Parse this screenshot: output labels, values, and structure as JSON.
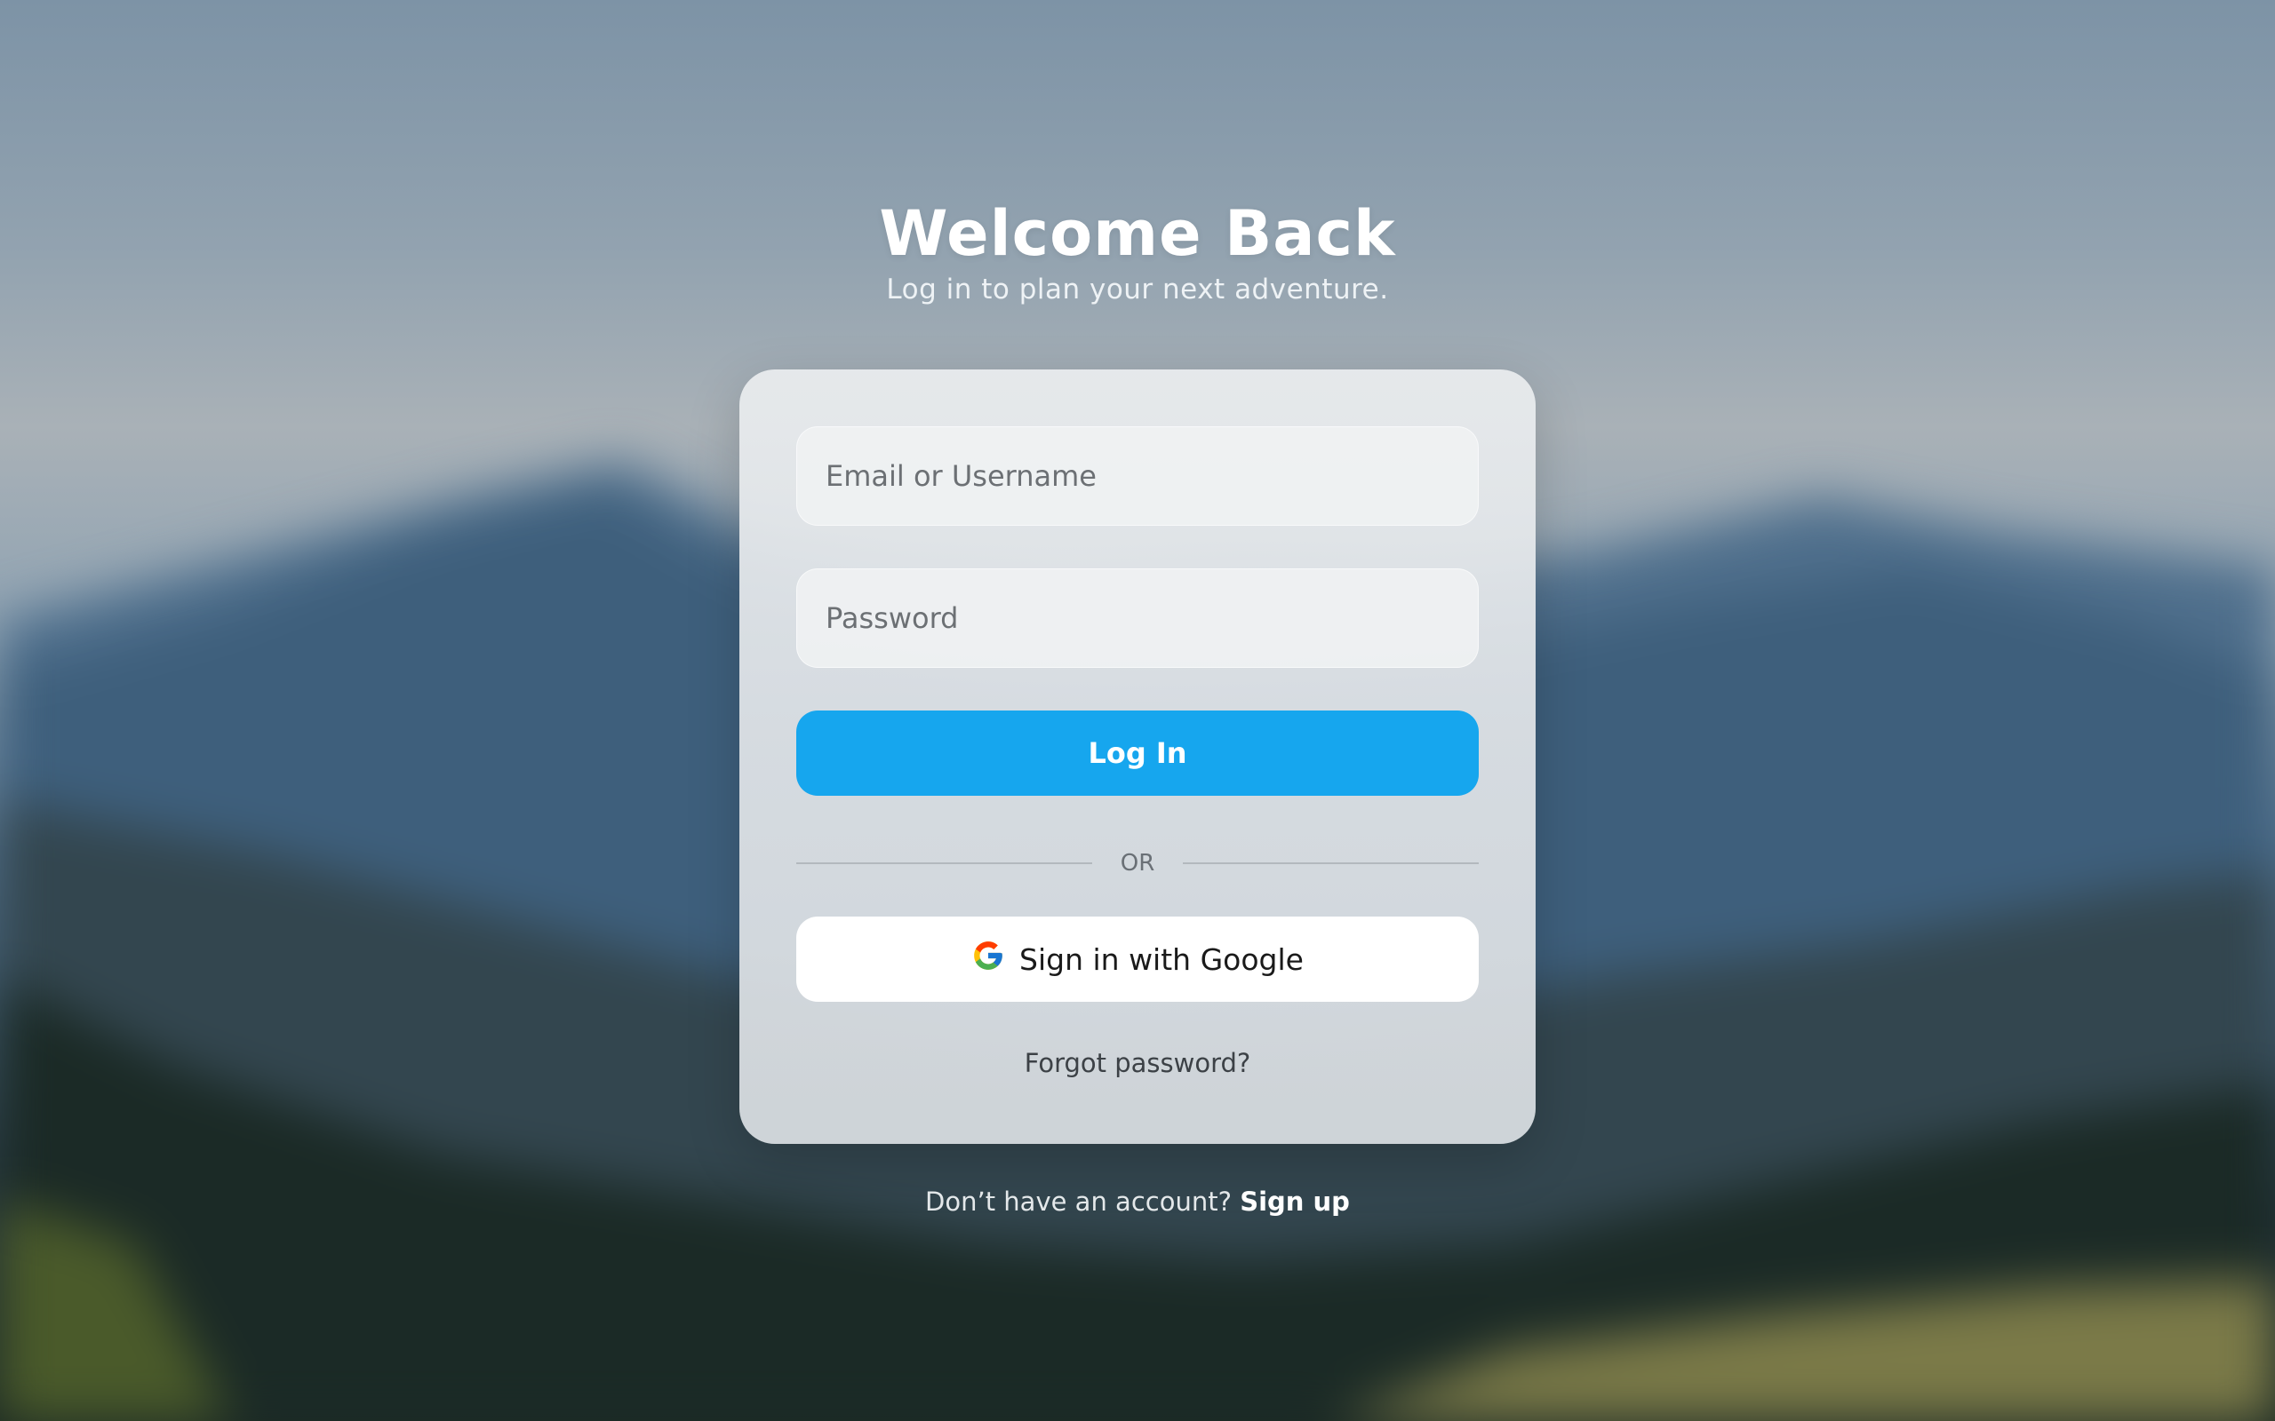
{
  "header": {
    "title": "Welcome Back",
    "subtitle": "Log in to plan your next adventure."
  },
  "form": {
    "email_placeholder": "Email or Username",
    "email_value": "",
    "password_placeholder": "Password",
    "password_value": "",
    "login_label": "Log In",
    "divider_label": "OR",
    "google_label": "Sign in with Google",
    "forgot_label": "Forgot password?"
  },
  "footer": {
    "prompt": "Don’t have an account?",
    "signup_label": "Sign up"
  },
  "icons": {
    "google": "google-icon"
  },
  "colors": {
    "primary": "#16a6ee",
    "card": "#dfe3e6",
    "google_button": "#ffffff"
  }
}
